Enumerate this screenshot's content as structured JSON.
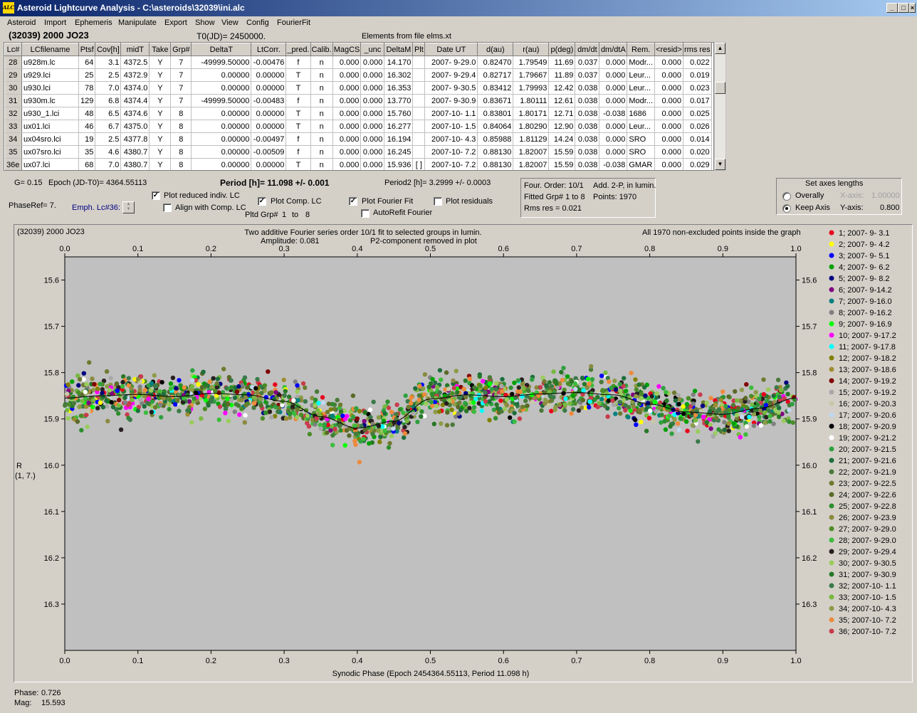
{
  "window": {
    "title": "Asteroid Lightcurve Analysis - C:\\asteroids\\32039\\ini.alc",
    "app_icon": "ALC",
    "controls": {
      "minimize": "_",
      "maximize": "□",
      "close": "×"
    }
  },
  "menu": [
    "Asteroid",
    "Import",
    "Ephemeris",
    "Manipulate",
    "Export",
    "Show",
    "View",
    "Config",
    "FourierFit"
  ],
  "header": {
    "object": "(32039) 2000 JO23",
    "t0": "T0(JD)= 2450000.",
    "elements": "Elements from file elms.xt"
  },
  "table": {
    "columns": [
      "Lc#",
      "LCfilename",
      "Ptsf",
      "Cov[h]",
      "midT",
      "Take",
      "Grp#",
      "DeltaT",
      "LtCorr.",
      "_pred.",
      "Calib.",
      "MagCS",
      "_unc",
      "DeltaM",
      "Plt",
      "Date UT",
      "d(au)",
      "r(au)",
      "p(deg)",
      "dm/dt",
      "dm/dtA",
      "Rem.",
      "<resid>",
      "rms res"
    ],
    "rows": [
      [
        "28",
        "u928m.lc",
        "64",
        "3.1",
        "4372.5",
        "Y",
        "7",
        "-49999.50000",
        "-0.00476",
        "f",
        "n",
        "0.000",
        "0.000",
        "14.170",
        "",
        "2007- 9-29.0",
        "0.82470",
        "1.79549",
        "11.69",
        "0.037",
        "0.000",
        "Modr...",
        "0.000",
        "0.022"
      ],
      [
        "29",
        "u929.lci",
        "25",
        "2.5",
        "4372.9",
        "Y",
        "7",
        "0.00000",
        "0.00000",
        "T",
        "n",
        "0.000",
        "0.000",
        "16.302",
        "",
        "2007- 9-29.4",
        "0.82717",
        "1.79667",
        "11.89",
        "0.037",
        "0.000",
        "Leur...",
        "0.000",
        "0.019"
      ],
      [
        "30",
        "u930.lci",
        "78",
        "7.0",
        "4374.0",
        "Y",
        "7",
        "0.00000",
        "0.00000",
        "T",
        "n",
        "0.000",
        "0.000",
        "16.353",
        "",
        "2007- 9-30.5",
        "0.83412",
        "1.79993",
        "12.42",
        "0.038",
        "0.000",
        "Leur...",
        "0.000",
        "0.023"
      ],
      [
        "31",
        "u930m.lc",
        "129",
        "6.8",
        "4374.4",
        "Y",
        "7",
        "-49999.50000",
        "-0.00483",
        "f",
        "n",
        "0.000",
        "0.000",
        "13.770",
        "",
        "2007- 9-30.9",
        "0.83671",
        "1.80111",
        "12.61",
        "0.038",
        "0.000",
        "Modr...",
        "0.000",
        "0.017"
      ],
      [
        "32",
        "u930_1.lci",
        "48",
        "6.5",
        "4374.6",
        "Y",
        "8",
        "0.00000",
        "0.00000",
        "T",
        "n",
        "0.000",
        "0.000",
        "15.760",
        "",
        "2007-10- 1.1",
        "0.83801",
        "1.80171",
        "12.71",
        "0.038",
        "-0.038",
        "1686",
        "0.000",
        "0.025"
      ],
      [
        "33",
        "ux01.lci",
        "46",
        "6.7",
        "4375.0",
        "Y",
        "8",
        "0.00000",
        "0.00000",
        "T",
        "n",
        "0.000",
        "0.000",
        "16.277",
        "",
        "2007-10- 1.5",
        "0.84064",
        "1.80290",
        "12.90",
        "0.038",
        "0.000",
        "Leur...",
        "0.000",
        "0.026"
      ],
      [
        "34",
        "ux04sro.lci",
        "19",
        "2.5",
        "4377.8",
        "Y",
        "8",
        "0.00000",
        "-0.00497",
        "f",
        "n",
        "0.000",
        "0.000",
        "16.194",
        "",
        "2007-10- 4.3",
        "0.85988",
        "1.81129",
        "14.24",
        "0.038",
        "0.000",
        "SRO",
        "0.000",
        "0.014"
      ],
      [
        "35",
        "ux07sro.lci",
        "35",
        "4.6",
        "4380.7",
        "Y",
        "8",
        "0.00000",
        "-0.00509",
        "f",
        "n",
        "0.000",
        "0.000",
        "16.245",
        "",
        "2007-10- 7.2",
        "0.88130",
        "1.82007",
        "15.59",
        "0.038",
        "0.000",
        "SRO",
        "0.000",
        "0.020"
      ],
      [
        "36e",
        "ux07.lci",
        "68",
        "7.0",
        "4380.7",
        "Y",
        "8",
        "0.00000",
        "0.00000",
        "T",
        "n",
        "0.000",
        "0.000",
        "15.936",
        "[ ]",
        "2007-10- 7.2",
        "0.88130",
        "1.82007",
        "15.59",
        "0.038",
        "-0.038",
        "GMAR",
        "0.000",
        "0.029"
      ]
    ]
  },
  "info": {
    "g": "G= 0.15",
    "epoch": "Epoch (JD-T0)= 4364.55113",
    "period": "Period [h]= 11.098 +/- 0.001",
    "period2": "Period2 [h]= 3.2999 +/- 0.0003",
    "phaseref": "PhaseRef= 7.",
    "emph": "Emph. Lc#36:",
    "pltd_grp": "Pltd Grp#",
    "pltd_from": "1",
    "pltd_to_label": "to",
    "pltd_to": "8"
  },
  "options": {
    "plot_reduced": {
      "label": "Plot reduced indiv. LC",
      "checked": true
    },
    "align_comp": {
      "label": "Align with Comp. LC",
      "checked": false
    },
    "plot_comp": {
      "label": "Plot Comp. LC",
      "checked": true
    },
    "plot_fourier": {
      "label": "Plot Fourier Fit",
      "checked": true
    },
    "autorefit": {
      "label": "AutoRefit Fourier",
      "checked": false
    },
    "plot_residuals": {
      "label": "Plot residuals",
      "checked": false
    }
  },
  "fitbox": {
    "order": "Four. Order: 10/1",
    "add": "Add. 2-P, in lumin.",
    "fitted": "Fitted Grp# 1 to 8",
    "points": "Points: 1970",
    "rms": "Rms res      = 0.021"
  },
  "axes_box": {
    "title": "Set axes lengths",
    "overally": "Overally",
    "keep_axis": "Keep Axis",
    "x_label": "X-axis:",
    "x_value": "1.00000",
    "y_label": "Y-axis:",
    "y_value": "0.800"
  },
  "status": {
    "phase_label": "Phase:",
    "phase": "0.726",
    "mag_label": "Mag:",
    "mag": "15.593"
  },
  "chart_data": {
    "type": "scatter",
    "title_left": "(32039) 2000 JO23",
    "title_center": "Two additive Fourier series order 10/1 fit to selected groups in lumin.",
    "amplitude": "Amplitude: 0.081",
    "p2_note": "P2-component removed in plot",
    "title_right": "All 1970 non-excluded points inside the graph",
    "xlabel": "Synodic Phase (Epoch 2454364.55113, Period 11.098 h)",
    "ylabel": "R",
    "ylabel2": "(1, 7.)",
    "xlim": [
      0,
      1
    ],
    "ylim": [
      16.4,
      15.55
    ],
    "y_reversed": true,
    "x_ticks": [
      "0.0",
      "0.1",
      "0.2",
      "0.3",
      "0.4",
      "0.5",
      "0.6",
      "0.7",
      "0.8",
      "0.9",
      "1.0"
    ],
    "y_ticks": [
      "15.6",
      "15.7",
      "15.8",
      "15.9",
      "16.0",
      "16.1",
      "16.2",
      "16.3"
    ],
    "fit_curve": {
      "phase": [
        0,
        0.05,
        0.1,
        0.15,
        0.2,
        0.25,
        0.3,
        0.35,
        0.4,
        0.45,
        0.5,
        0.55,
        0.6,
        0.65,
        0.7,
        0.75,
        0.8,
        0.85,
        0.9,
        0.95,
        1.0
      ],
      "mag": [
        15.855,
        15.85,
        15.847,
        15.852,
        15.845,
        15.848,
        15.862,
        15.895,
        15.92,
        15.905,
        15.857,
        15.848,
        15.852,
        15.846,
        15.843,
        15.848,
        15.868,
        15.885,
        15.89,
        15.877,
        15.855
      ]
    },
    "scatter_sigma": 0.022,
    "n_points": 1970,
    "legend": [
      {
        "label": "1; 2007- 9- 3.1",
        "color": "#e8001c"
      },
      {
        "label": "2; 2007- 9- 4.2",
        "color": "#ffff00"
      },
      {
        "label": "3; 2007- 9- 5.1",
        "color": "#0000ff"
      },
      {
        "label": "4; 2007- 9- 6.2",
        "color": "#00a000"
      },
      {
        "label": "5; 2007- 9- 8.2",
        "color": "#000080"
      },
      {
        "label": "6; 2007- 9-14.2",
        "color": "#800080"
      },
      {
        "label": "7; 2007- 9-16.0",
        "color": "#008080"
      },
      {
        "label": "8; 2007- 9-16.2",
        "color": "#808080"
      },
      {
        "label": "9; 2007- 9-16.9",
        "color": "#00ff00"
      },
      {
        "label": "10; 2007- 9-17.2",
        "color": "#ff00ff"
      },
      {
        "label": "11; 2007- 9-17.8",
        "color": "#00ffff"
      },
      {
        "label": "12; 2007- 9-18.2",
        "color": "#808000"
      },
      {
        "label": "13; 2007- 9-18.6",
        "color": "#9e8c30"
      },
      {
        "label": "14; 2007- 9-19.2",
        "color": "#800000"
      },
      {
        "label": "15; 2007- 9-19.2",
        "color": "#a8a8a8"
      },
      {
        "label": "16; 2007- 9-20.3",
        "color": "#c8c8a8"
      },
      {
        "label": "17; 2007- 9-20.6",
        "color": "#c0d8f0"
      },
      {
        "label": "18; 2007- 9-20.9",
        "color": "#000000"
      },
      {
        "label": "19; 2007- 9-21.2",
        "color": "#ffffff"
      },
      {
        "label": "20; 2007- 9-21.5",
        "color": "#30a040"
      },
      {
        "label": "21; 2007- 9-21.6",
        "color": "#1e6e3c"
      },
      {
        "label": "22; 2007- 9-21.9",
        "color": "#4a7a3a"
      },
      {
        "label": "23; 2007- 9-22.5",
        "color": "#6e7a30"
      },
      {
        "label": "24; 2007- 9-22.6",
        "color": "#5a6a28"
      },
      {
        "label": "25; 2007- 9-22.8",
        "color": "#2e8e2e"
      },
      {
        "label": "26; 2007- 9-23.9",
        "color": "#8a8a40"
      },
      {
        "label": "27; 2007- 9-29.0",
        "color": "#4c8c28"
      },
      {
        "label": "28; 2007- 9-29.0",
        "color": "#3cbc3c"
      },
      {
        "label": "29; 2007- 9-29.4",
        "color": "#282020"
      },
      {
        "label": "30; 2007- 9-30.5",
        "color": "#9acc5c"
      },
      {
        "label": "31; 2007- 9-30.9",
        "color": "#287828"
      },
      {
        "label": "32; 2007-10- 1.1",
        "color": "#3a7a4a"
      },
      {
        "label": "33; 2007-10- 1.5",
        "color": "#78b840"
      },
      {
        "label": "34; 2007-10- 4.3",
        "color": "#8c9c48"
      },
      {
        "label": "35; 2007-10- 7.2",
        "color": "#ee8a3c"
      },
      {
        "label": "36; 2007-10- 7.2",
        "color": "#c83c4c"
      }
    ]
  }
}
